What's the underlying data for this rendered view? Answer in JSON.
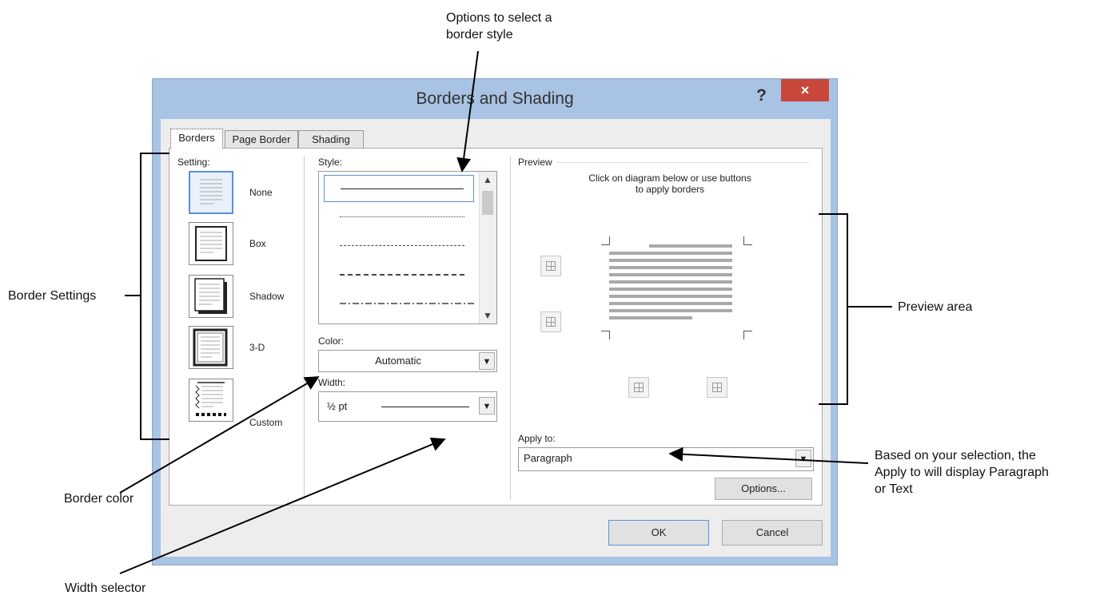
{
  "callouts": {
    "style_options": "Options to select a\nborder style",
    "border_settings": "Border Settings",
    "preview_area": "Preview area",
    "border_color": "Border color",
    "apply_to_note": "Based on your selection, the\nApply to will display Paragraph\nor Text",
    "width_selector": "Width selector"
  },
  "dialog": {
    "title": "Borders and Shading",
    "help": "?",
    "close": "×",
    "tabs": [
      {
        "label": "Borders",
        "active": true
      },
      {
        "label": "Page Border",
        "active": false
      },
      {
        "label": "Shading",
        "active": false
      }
    ],
    "setting": {
      "label": "Setting:",
      "items": [
        "None",
        "Box",
        "Shadow",
        "3-D",
        "Custom"
      ]
    },
    "style": {
      "label": "Style:",
      "items": [
        "solid",
        "dotted",
        "fine-dashed",
        "dashed",
        "dash-dot"
      ]
    },
    "color": {
      "label": "Color:",
      "value": "Automatic"
    },
    "width": {
      "label": "Width:",
      "value": "½ pt"
    },
    "preview": {
      "label": "Preview",
      "instruction": "Click on diagram below or use buttons\nto apply borders"
    },
    "apply_to": {
      "label": "Apply to:",
      "value": "Paragraph"
    },
    "options_button": "Options...",
    "ok_button": "OK",
    "cancel_button": "Cancel"
  },
  "colors": {
    "titlebar": "#a8c3e3",
    "close": "#c9473a",
    "accent": "#5b8fd6"
  }
}
